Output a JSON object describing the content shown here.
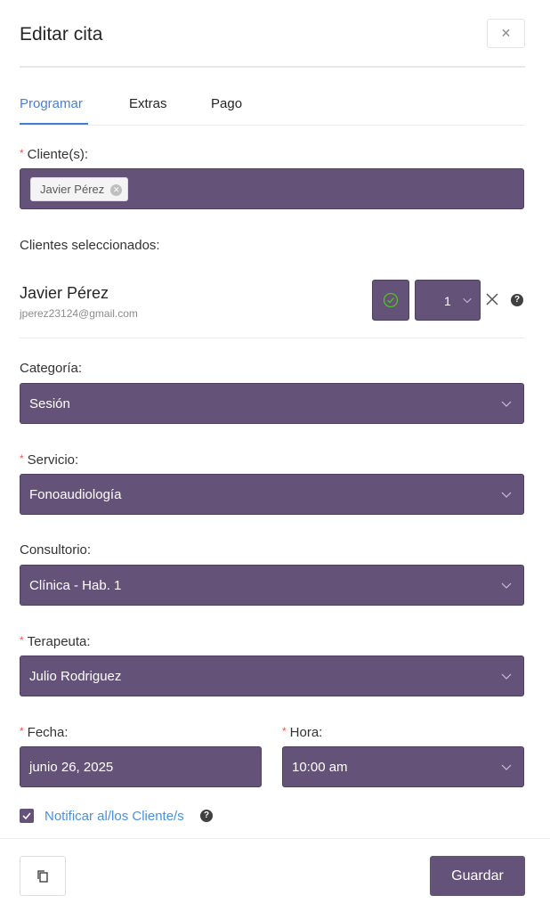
{
  "modal": {
    "title": "Editar cita",
    "close_icon": "close-icon"
  },
  "tabs": [
    {
      "label": "Programar",
      "active": true
    },
    {
      "label": "Extras",
      "active": false
    },
    {
      "label": "Pago",
      "active": false
    }
  ],
  "required_marker": "*",
  "clients_field": {
    "label": "Cliente(s):",
    "tags": [
      {
        "label": "Javier Pérez"
      }
    ]
  },
  "selected_clients": {
    "label": "Clientes seleccionados:",
    "items": [
      {
        "name": "Javier Pérez",
        "email": "jperez23124@gmail.com",
        "quantity": "1",
        "confirmed": true
      }
    ]
  },
  "category": {
    "label": "Categoría:",
    "value": "Sesión"
  },
  "service": {
    "label": "Servicio:",
    "value": "Fonoaudiología"
  },
  "office": {
    "label": "Consultorio:",
    "value": "Clínica - Hab. 1"
  },
  "therapist": {
    "label": "Terapeuta:",
    "value": "Julio Rodriguez"
  },
  "date": {
    "label": "Fecha:",
    "value": "junio 26, 2025"
  },
  "time": {
    "label": "Hora:",
    "value": "10:00 am"
  },
  "notify": {
    "label": "Notificar al/los Cliente/s",
    "checked": true
  },
  "footer": {
    "save_label": "Guardar",
    "copy_icon": "copy-icon"
  },
  "colors": {
    "field_bg": "#655279",
    "accent_blue": "#4a7fd0",
    "link_blue": "#4a90e2",
    "required_red": "#ff4d4f",
    "check_green": "#52c41a"
  }
}
